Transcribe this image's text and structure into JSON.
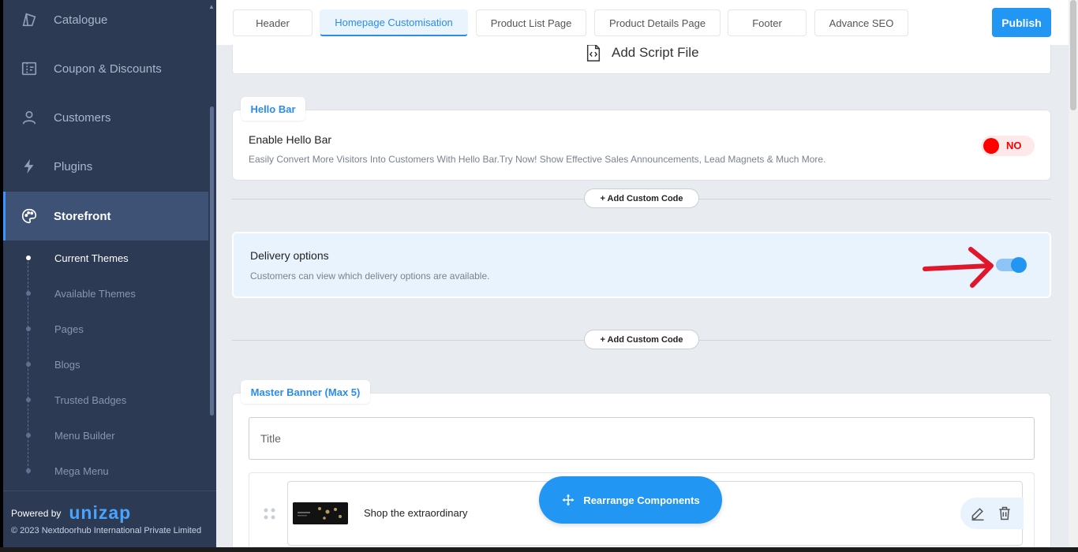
{
  "sidebar": {
    "items": [
      {
        "label": "Catalogue",
        "icon": "catalogue-icon"
      },
      {
        "label": "Coupon & Discounts",
        "icon": "coupon-icon"
      },
      {
        "label": "Customers",
        "icon": "user-icon"
      },
      {
        "label": "Plugins",
        "icon": "bolt-icon"
      },
      {
        "label": "Storefront",
        "icon": "palette-icon"
      }
    ],
    "sub_items": [
      {
        "label": "Current Themes"
      },
      {
        "label": "Available Themes"
      },
      {
        "label": "Pages"
      },
      {
        "label": "Blogs"
      },
      {
        "label": "Trusted Badges"
      },
      {
        "label": "Menu Builder"
      },
      {
        "label": "Mega Menu"
      }
    ],
    "powered_by": "Powered by",
    "logo_text": "unizap",
    "copyright": "© 2023 Nextdoorhub International Private Limited"
  },
  "tabs": [
    {
      "label": "Header"
    },
    {
      "label": "Homepage Customisation"
    },
    {
      "label": "Product List Page"
    },
    {
      "label": "Product Details Page"
    },
    {
      "label": "Footer"
    },
    {
      "label": "Advance SEO"
    }
  ],
  "publish_label": "Publish",
  "script_card": {
    "label": "Add Script File"
  },
  "hello_bar": {
    "chip": "Hello Bar",
    "title": "Enable Hello Bar",
    "description": "Easily Convert More Visitors Into Customers With Hello Bar.Try Now! Show Effective Sales Announcements, Lead Magnets & Much More.",
    "toggle_text": "NO"
  },
  "add_custom_code": "+ Add Custom Code",
  "delivery": {
    "title": "Delivery options",
    "description": "Customers can view which delivery options are available."
  },
  "master_banner": {
    "chip": "Master Banner (Max 5)",
    "title_placeholder": "Title",
    "row_text": "Shop the extraordinary"
  },
  "rearrange_label": "Rearrange Components",
  "colors": {
    "accent": "#2196f3",
    "sidebar_bg": "#2c3a53",
    "toggle_off": "#ff0000",
    "arrow": "#e0162b"
  }
}
